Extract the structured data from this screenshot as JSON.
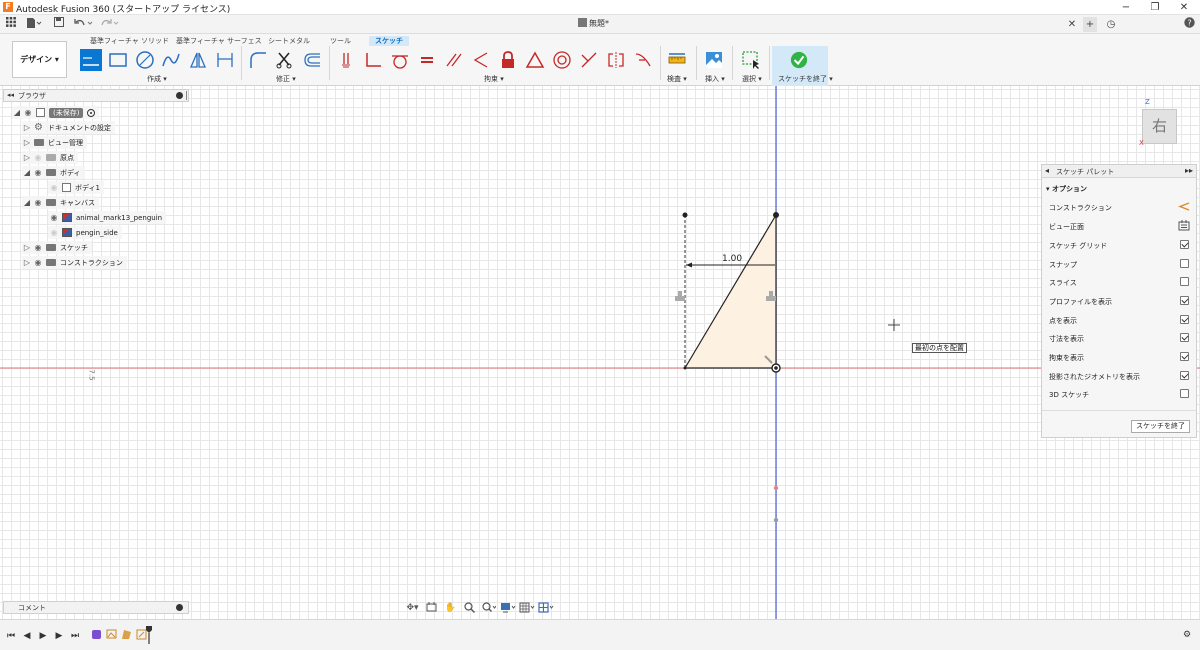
{
  "window": {
    "title": "Autodesk Fusion 360 (スタートアップ ライセンス)",
    "app_icon": "F",
    "document_tab": "無題*",
    "controls": {
      "minimize": "−",
      "maximize": "❐",
      "close": "✕"
    }
  },
  "quickbar": {
    "grid_icon": "grid-menu-icon",
    "file_label": "file-menu",
    "tab_close": "✕",
    "tab_add": "+",
    "clock": "◷",
    "help": "?"
  },
  "ribbon": {
    "workspace_button": "デザイン ▾",
    "tabs": [
      "基準フィーチャ ソリッド",
      "基準フィーチャ サーフェス",
      "シートメタル",
      "ツール",
      "スケッチ"
    ],
    "active_tab": "スケッチ",
    "groups": {
      "create": "作成 ▾",
      "modify": "修正 ▾",
      "constraints": "拘束 ▾",
      "inspect": "検査 ▾",
      "insert": "挿入 ▾",
      "select": "選択 ▾",
      "finish": "スケッチを終了 ▾"
    }
  },
  "browser": {
    "header": "ブラウザ",
    "items": [
      {
        "label": "(未保存)",
        "type": "root"
      },
      {
        "label": "ドキュメントの設定",
        "icon": "gear-icon"
      },
      {
        "label": "ビュー管理",
        "icon": "folder-icon"
      },
      {
        "label": "原点",
        "icon": "folder-icon"
      },
      {
        "label": "ボディ",
        "icon": "folder-icon"
      },
      {
        "label": "ボディ1",
        "icon": "body-icon"
      },
      {
        "label": "キャンバス",
        "icon": "folder-icon"
      },
      {
        "label": "animal_mark13_penguin",
        "icon": "image-icon"
      },
      {
        "label": "pengin_side",
        "icon": "image-icon"
      },
      {
        "label": "スケッチ",
        "icon": "folder-icon"
      },
      {
        "label": "コンストラクション",
        "icon": "folder-icon"
      }
    ]
  },
  "comments": {
    "label": "コメント"
  },
  "viewcube": {
    "face": "右",
    "z": "Z",
    "x": "X"
  },
  "canvas": {
    "dimension": "1.00",
    "tooltip": "最初の点を配置",
    "axis_label": "7.5"
  },
  "palette": {
    "header": "スケッチ パレット",
    "section": "▾ オプション",
    "options": [
      {
        "label": "コンストラクション",
        "control": "construction-icon"
      },
      {
        "label": "ビュー正面",
        "control": "look-at-icon"
      },
      {
        "label": "スケッチ グリッド",
        "checked": true
      },
      {
        "label": "スナップ",
        "checked": false
      },
      {
        "label": "スライス",
        "checked": false
      },
      {
        "label": "プロファイルを表示",
        "checked": true
      },
      {
        "label": "点を表示",
        "checked": true
      },
      {
        "label": "寸法を表示",
        "checked": true
      },
      {
        "label": "拘束を表示",
        "checked": true
      },
      {
        "label": "投影されたジオメトリを表示",
        "checked": true
      },
      {
        "label": "3D スケッチ",
        "checked": false
      }
    ],
    "finish_button": "スケッチを終了"
  },
  "colors": {
    "accent": "#0a78d2",
    "x_axis": "#e05a5a",
    "y_axis": "#3a4fd0",
    "profile_fill": "#fdf1e1",
    "finish_green": "#2fb344"
  }
}
